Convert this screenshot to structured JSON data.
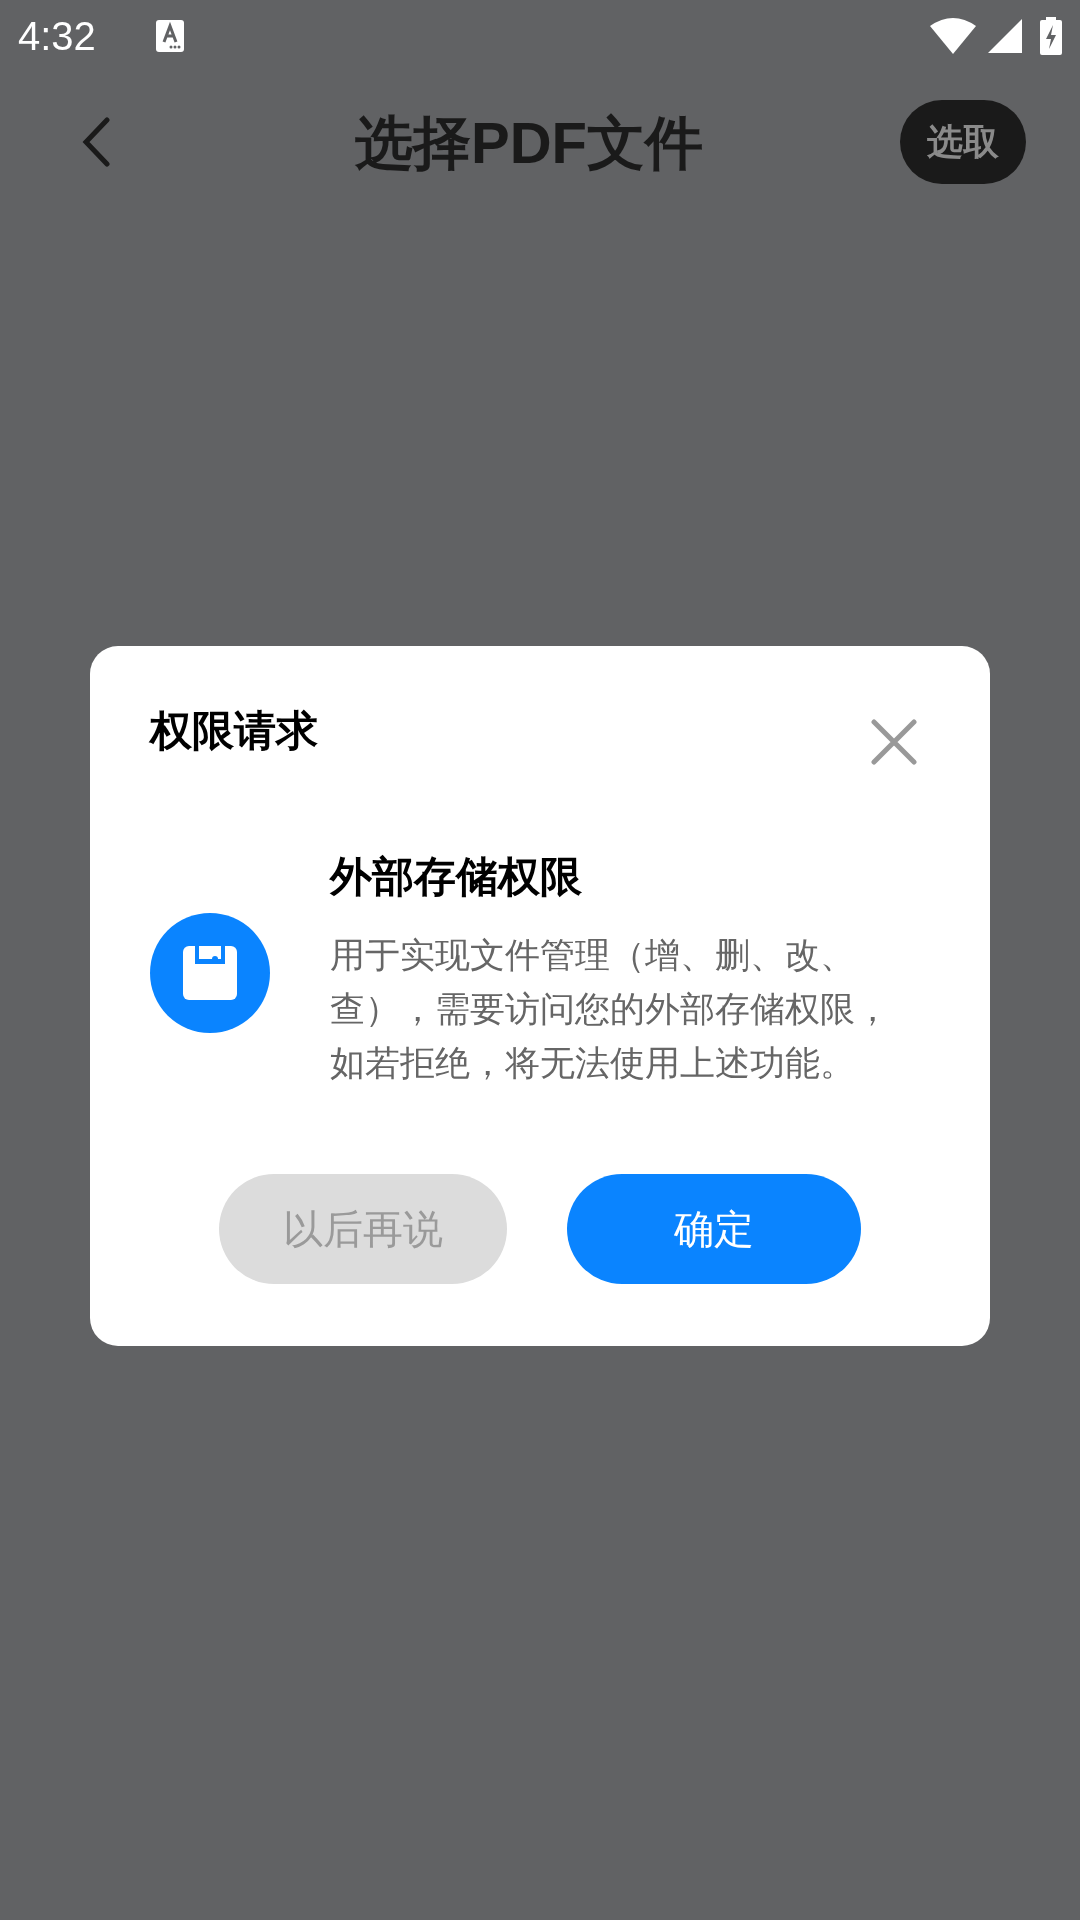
{
  "status_bar": {
    "time": "4:32"
  },
  "header": {
    "title": "选择PDF文件",
    "action": "选取"
  },
  "dialog": {
    "title": "权限请求",
    "permission_title": "外部存储权限",
    "description": "用于实现文件管理（增、删、改、查），需要访问您的外部存储权限，如若拒绝，将无法使用上述功能。",
    "buttons": [
      {
        "label": "以后再说",
        "kind": "secondary"
      },
      {
        "label": "确定",
        "kind": "primary"
      }
    ]
  }
}
